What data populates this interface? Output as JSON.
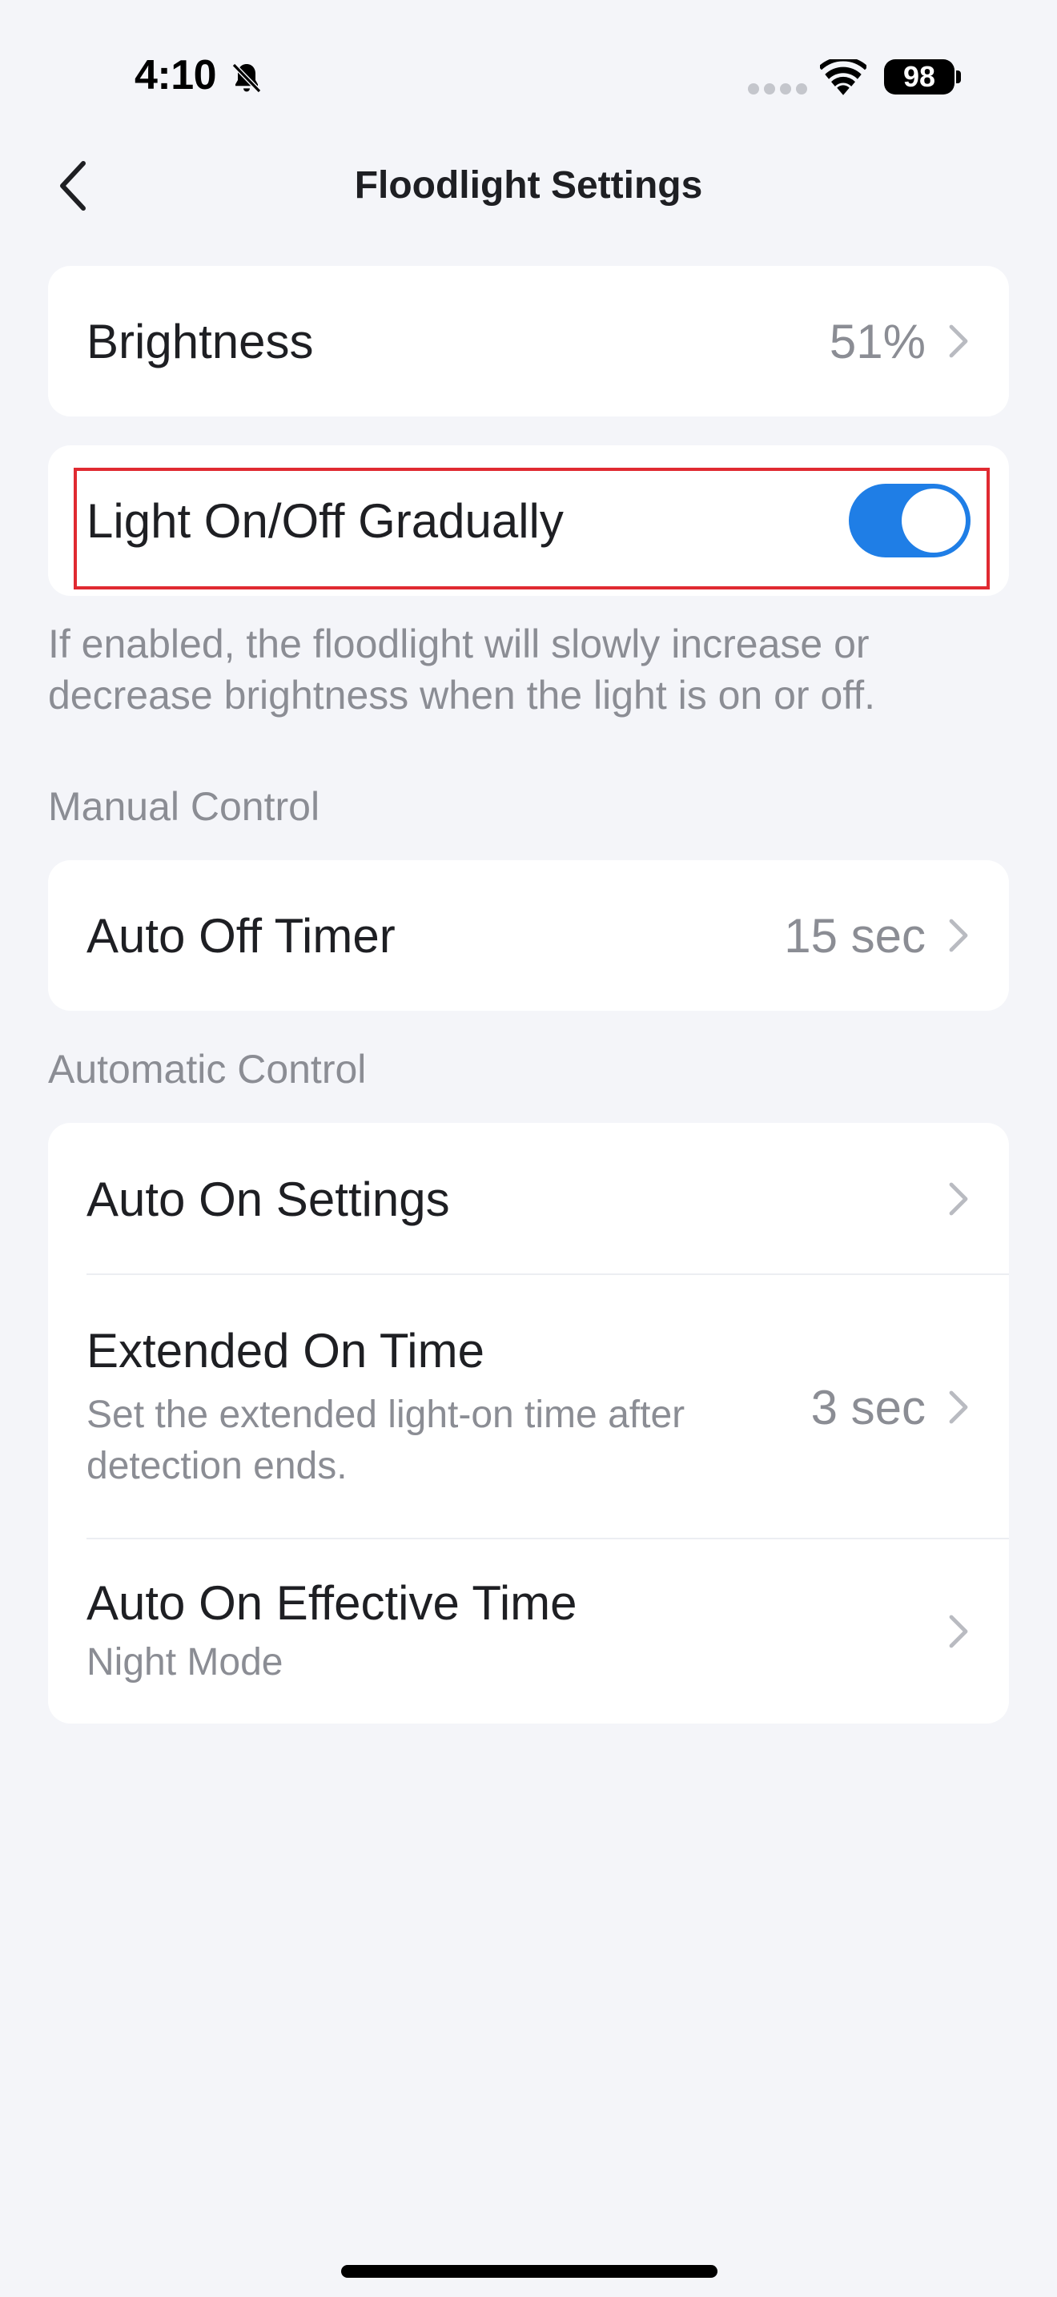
{
  "status_bar": {
    "time": "4:10",
    "battery": "98"
  },
  "nav": {
    "title": "Floodlight Settings"
  },
  "brightness": {
    "label": "Brightness",
    "value": "51%"
  },
  "gradual": {
    "label": "Light On/Off Gradually",
    "enabled": true,
    "help": "If enabled, the floodlight will slowly increase or decrease brightness when the light is on or off."
  },
  "manual_control": {
    "section_label": "Manual Control",
    "auto_off_timer": {
      "label": "Auto Off Timer",
      "value": "15 sec"
    }
  },
  "automatic_control": {
    "section_label": "Automatic Control",
    "auto_on_settings": {
      "label": "Auto On Settings"
    },
    "extended_on_time": {
      "label": "Extended On Time",
      "sub": "Set the extended light-on time after detection ends.",
      "value": "3 sec"
    },
    "auto_on_effective_time": {
      "label": "Auto On Effective Time",
      "sub": "Night Mode"
    }
  },
  "colors": {
    "accent": "#1f7ee6",
    "highlight": "#e02a31",
    "background": "#f4f5f9"
  },
  "icons": {
    "back": "chevron-left-icon",
    "row": "chevron-right-icon",
    "bell": "bell-slash-icon",
    "wifi": "wifi-icon"
  }
}
